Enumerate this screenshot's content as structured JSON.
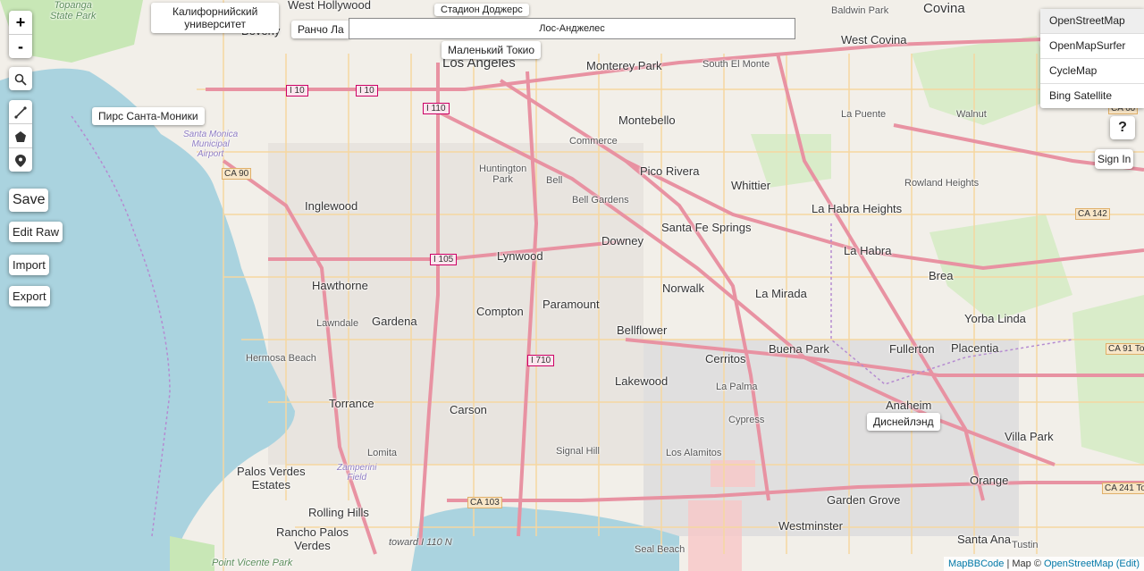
{
  "zoom_controls": {
    "zoom_in": "+",
    "zoom_out": "-"
  },
  "left_tools": {
    "search_icon": "search-icon",
    "line_icon": "draw-line-icon",
    "polygon_icon": "draw-polygon-icon",
    "marker_icon": "marker-icon"
  },
  "side_buttons": {
    "save": "Save",
    "edit_raw": "Edit Raw",
    "import": "Import",
    "export": "Export"
  },
  "search": {
    "value": "Лос-Анджелес"
  },
  "tooltips": {
    "ucla": "Калифорнийский\nуниверситет",
    "rancho": "Ранчо Ла",
    "little_tokyo": "Маленький Токио",
    "santa_monica_pier": "Пирс Санта-Моники",
    "disneyland": "Диснейлэнд",
    "dodger": "Стадион Доджерс"
  },
  "layers": [
    "OpenStreetMap",
    "OpenMapSurfer",
    "CycleMap",
    "Bing Satellite"
  ],
  "active_layer": "OpenStreetMap",
  "help_label": "?",
  "sign_in_label": "Sign In",
  "attribution": {
    "mapbbcode": "MapBBCode",
    "sep1": " | Map © ",
    "osm": "OpenStreetMap",
    "edit": "(Edit)"
  },
  "places": {
    "west_hollywood": "West Hollywood",
    "beverly": "Beverly",
    "los_angeles": "Los Angeles",
    "monterey_park": "Monterey Park",
    "south_el_monte": "South El Monte",
    "el_monte": "El Monte",
    "baldwin_park": "Baldwin Park",
    "covina": "Covina",
    "west_covina": "West Covina",
    "montebello": "Montebello",
    "la_puente": "La Puente",
    "walnut": "Walnut",
    "commerce": "Commerce",
    "huntington_park": "Huntington\nPark",
    "bell": "Bell",
    "pico_rivera": "Pico Rivera",
    "whittier": "Whittier",
    "rowland_heights": "Rowland Heights",
    "inglewood": "Inglewood",
    "bell_gardens": "Bell Gardens",
    "santa_fe_springs": "Santa Fe Springs",
    "la_habra_heights": "La Habra Heights",
    "downey": "Downey",
    "la_habra": "La Habra",
    "lynwood": "Lynwood",
    "hawthorne": "Hawthorne",
    "norwalk": "Norwalk",
    "la_mirada": "La Mirada",
    "brea": "Brea",
    "paramount": "Paramount",
    "compton": "Compton",
    "gardena": "Gardena",
    "lawndale": "Lawndale",
    "bellflower": "Bellflower",
    "yorba_linda": "Yorba Linda",
    "buena_park": "Buena Park",
    "fullerton": "Fullerton",
    "placentia": "Placentia",
    "hermosa_beach": "Hermosa Beach",
    "cerritos": "Cerritos",
    "torrance": "Torrance",
    "lakewood": "Lakewood",
    "la_palma": "La Palma",
    "anaheim": "Anaheim",
    "carson": "Carson",
    "cypress": "Cypress",
    "villa_park": "Villa Park",
    "lomita": "Lomita",
    "signal_hill": "Signal Hill",
    "los_alamitos": "Los Alamitos",
    "palos_verdes_estates": "Palos Verdes\nEstates",
    "orange": "Orange",
    "rolling_hills": "Rolling Hills",
    "garden_grove": "Garden Grove",
    "rancho_palos_verdes": "Rancho Palos\nVerdes",
    "westminster": "Westminster",
    "santa_ana": "Santa Ana",
    "tustin": "Tustin",
    "seal_beach": "Seal Beach",
    "topanga": "Topanga\nState Park",
    "santa_monica_airport": "Santa Monica\nMunicipal\nAirport",
    "zamperini": "Zamperini\nField",
    "point_vicente": "Point Vicente\nPark",
    "toward_i110": "toward I 110 N"
  },
  "shields": [
    "I 10",
    "I 10",
    "I 110",
    "I 105",
    "I 710",
    "CA 90",
    "CA 103",
    "CA 142",
    "CA 91 To",
    "CA 241 To",
    "CA 60"
  ],
  "colors": {
    "water": "#aad3df",
    "land": "#f2efe9",
    "motorway": "#e892a2",
    "primary": "#fcd6a4",
    "park": "#c8facc",
    "urban": "#e0dfdf"
  }
}
